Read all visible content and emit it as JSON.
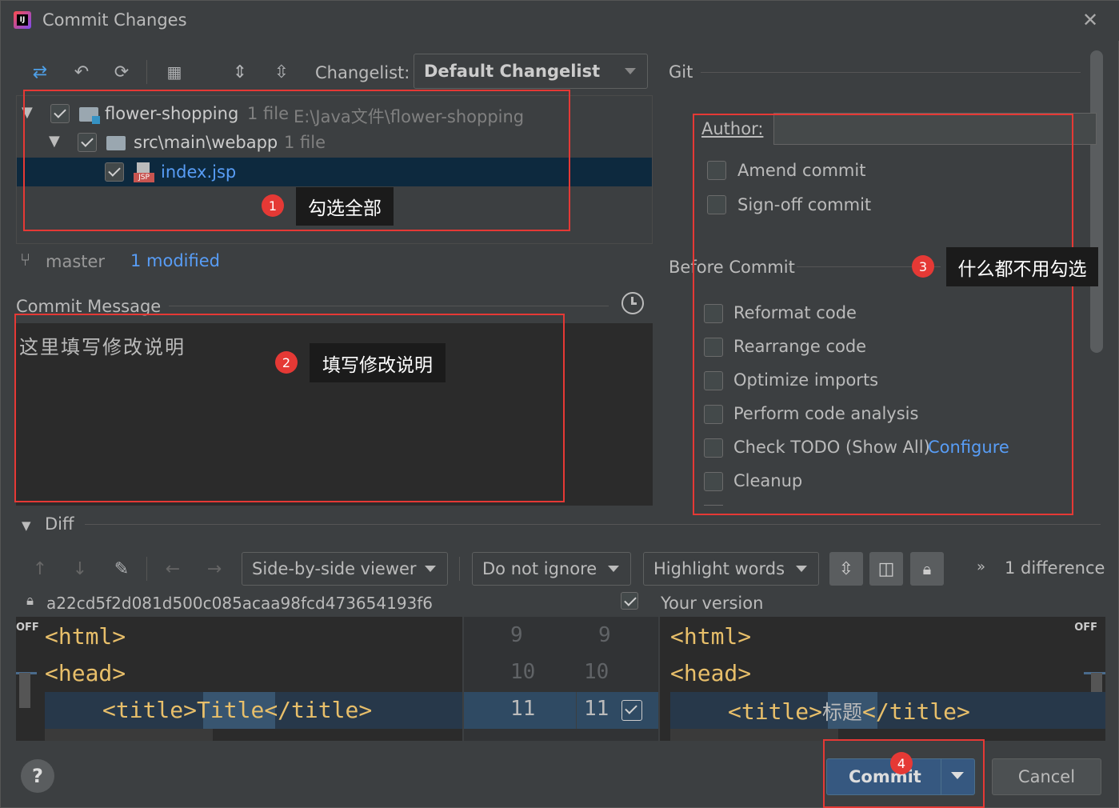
{
  "window": {
    "title": "Commit Changes"
  },
  "toolbar": {
    "changelist_label": "Changelist:",
    "changelist_value": "Default Changelist"
  },
  "tree": {
    "root": {
      "name": "flower-shopping",
      "count": "1 file",
      "path": "E:\\Java文件\\flower-shopping"
    },
    "folder": {
      "name": "src\\main\\webapp",
      "count": "1 file"
    },
    "file": {
      "name": "index.jsp",
      "icon_label": "JSP"
    }
  },
  "status": {
    "branch": "master",
    "modified": "1 modified"
  },
  "commit_message": {
    "label": "Commit Message",
    "text": "这里填写修改说明"
  },
  "git": {
    "section": "Git",
    "author_label": "Author:",
    "author_value": "",
    "amend": "Amend commit",
    "signoff": "Sign-off commit"
  },
  "before_commit": {
    "label": "Before Commit",
    "items": [
      "Reformat code",
      "Rearrange code",
      "Optimize imports",
      "Perform code analysis",
      "Check TODO (Show All)",
      "Cleanup"
    ],
    "configure_link": "Configure"
  },
  "diff": {
    "label": "Diff",
    "viewer": "Side-by-side viewer",
    "ignore": "Do not ignore",
    "highlight": "Highlight words",
    "difference_count": "1 difference",
    "left_hash": "a22cd5f2d081d500c085acaa98fcd473654193f6",
    "right_label": "Your version",
    "off_left": "OFF",
    "off_right": "OFF",
    "left_lines": [
      "<html>",
      "<head>",
      "<title>Title</title>"
    ],
    "right_lines": [
      "<html>",
      "<head>",
      "<title>标题</title>"
    ],
    "left_nums": [
      "9",
      "10",
      "11"
    ],
    "right_nums": [
      "9",
      "10",
      "11"
    ],
    "left_changed_word": "Title",
    "right_changed_word": "标题"
  },
  "footer": {
    "help": "?",
    "commit": "Commit",
    "cancel": "Cancel"
  },
  "annotations": {
    "a1": {
      "num": "1",
      "text": "勾选全部"
    },
    "a2": {
      "num": "2",
      "text": "填写修改说明"
    },
    "a3": {
      "num": "3",
      "text": "什么都不用勾选"
    },
    "a4": {
      "num": "4"
    }
  },
  "colors": {
    "accent": "#365880",
    "annotation": "#e53935",
    "link": "#589df6",
    "tag": "#e8bf6a"
  }
}
